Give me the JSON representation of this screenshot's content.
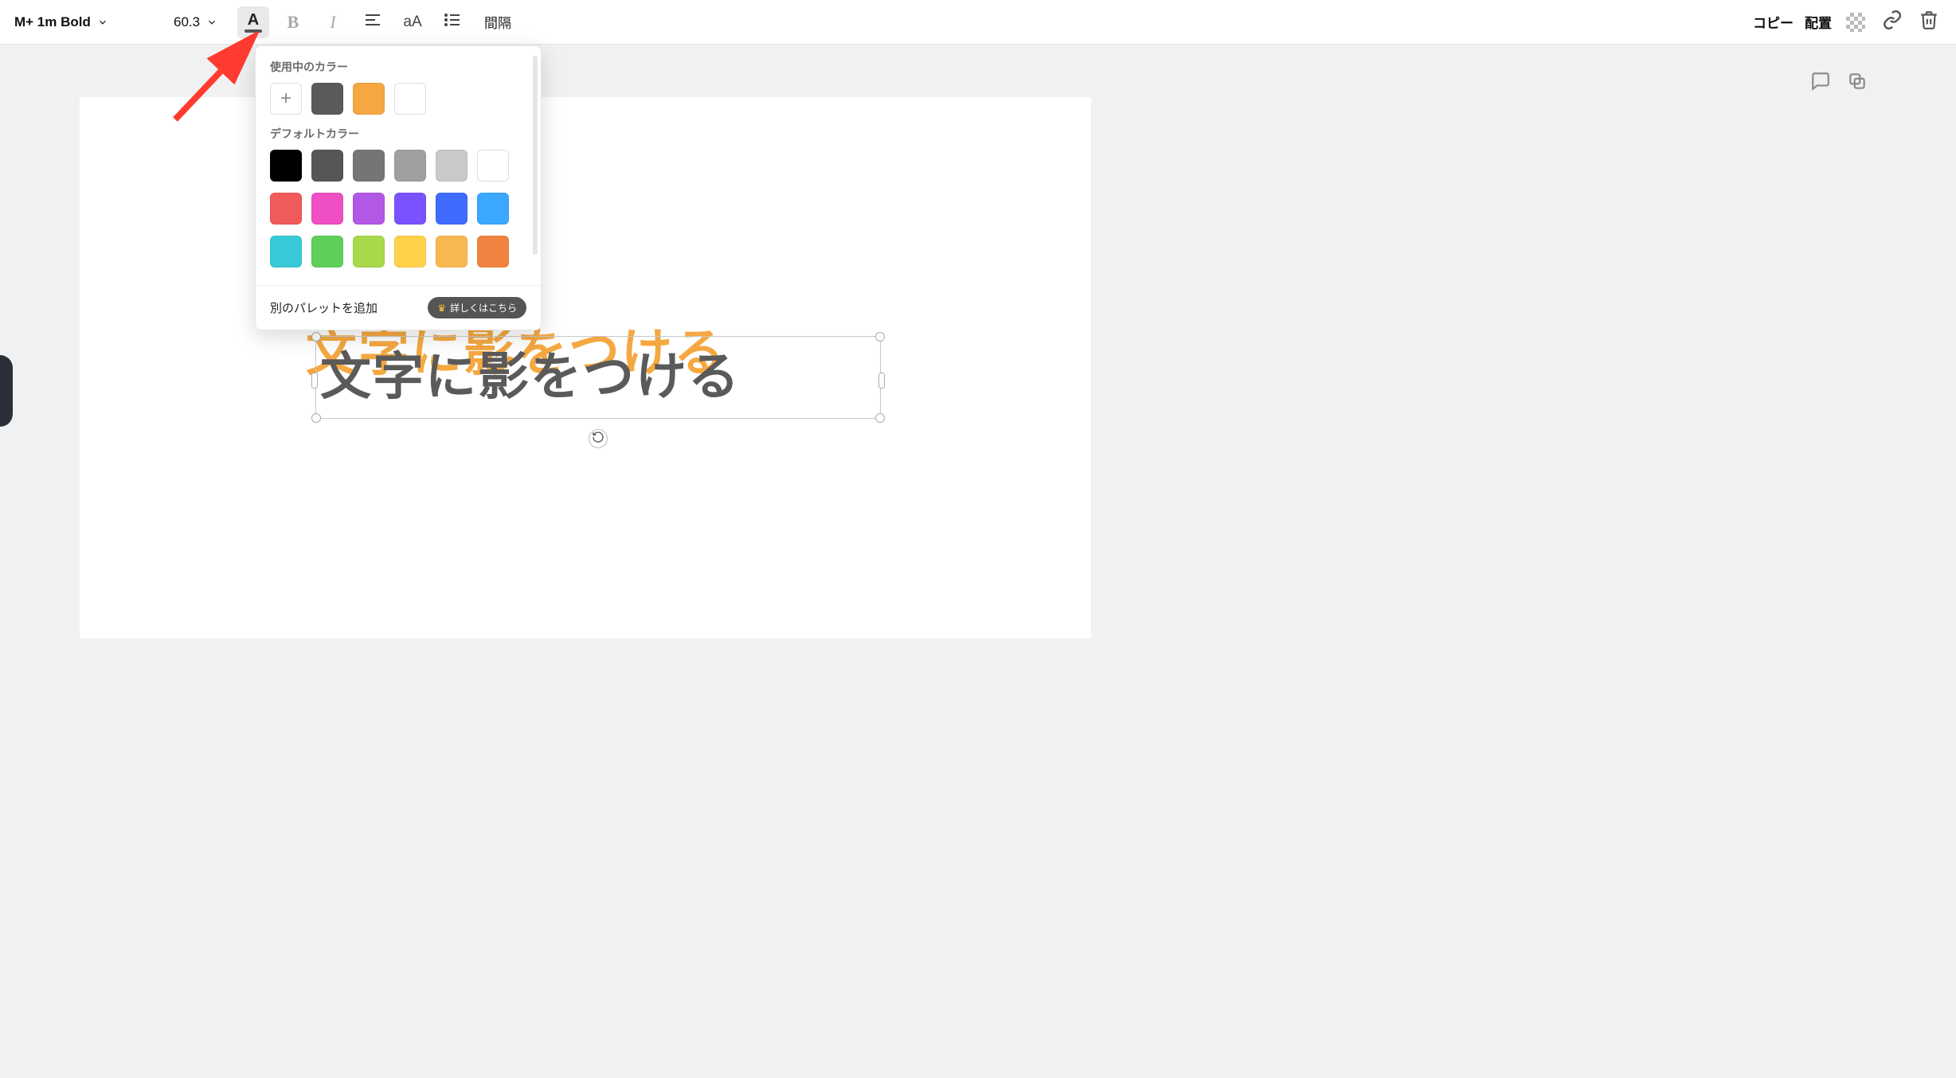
{
  "toolbar": {
    "font_name": "M+ 1m Bold",
    "font_size": "60.3",
    "spacing_label": "間隔",
    "copy_label": "コピー",
    "position_label": "配置"
  },
  "popover": {
    "section_used": "使用中のカラー",
    "section_default": "デフォルトカラー",
    "used_colors": [
      "#5a5a5a",
      "#f5a841",
      "#ffffff"
    ],
    "default_colors_row1": [
      "#000000",
      "#565656",
      "#757575",
      "#a0a0a0",
      "#c9c9c9",
      "#ffffff"
    ],
    "default_colors_row2": [
      "#f15a5a",
      "#ef4fc2",
      "#b257e6",
      "#7a52ff",
      "#3f6bff",
      "#3aa8ff"
    ],
    "default_colors_row3": [
      "#37c9d6",
      "#5fcf5a",
      "#a7d94a",
      "#ffd24a",
      "#f7b851",
      "#f0833f"
    ],
    "footer_label": "別のパレットを追加",
    "footer_cta": "詳しくはこちら"
  },
  "canvas": {
    "text": "文字に影をつける"
  }
}
